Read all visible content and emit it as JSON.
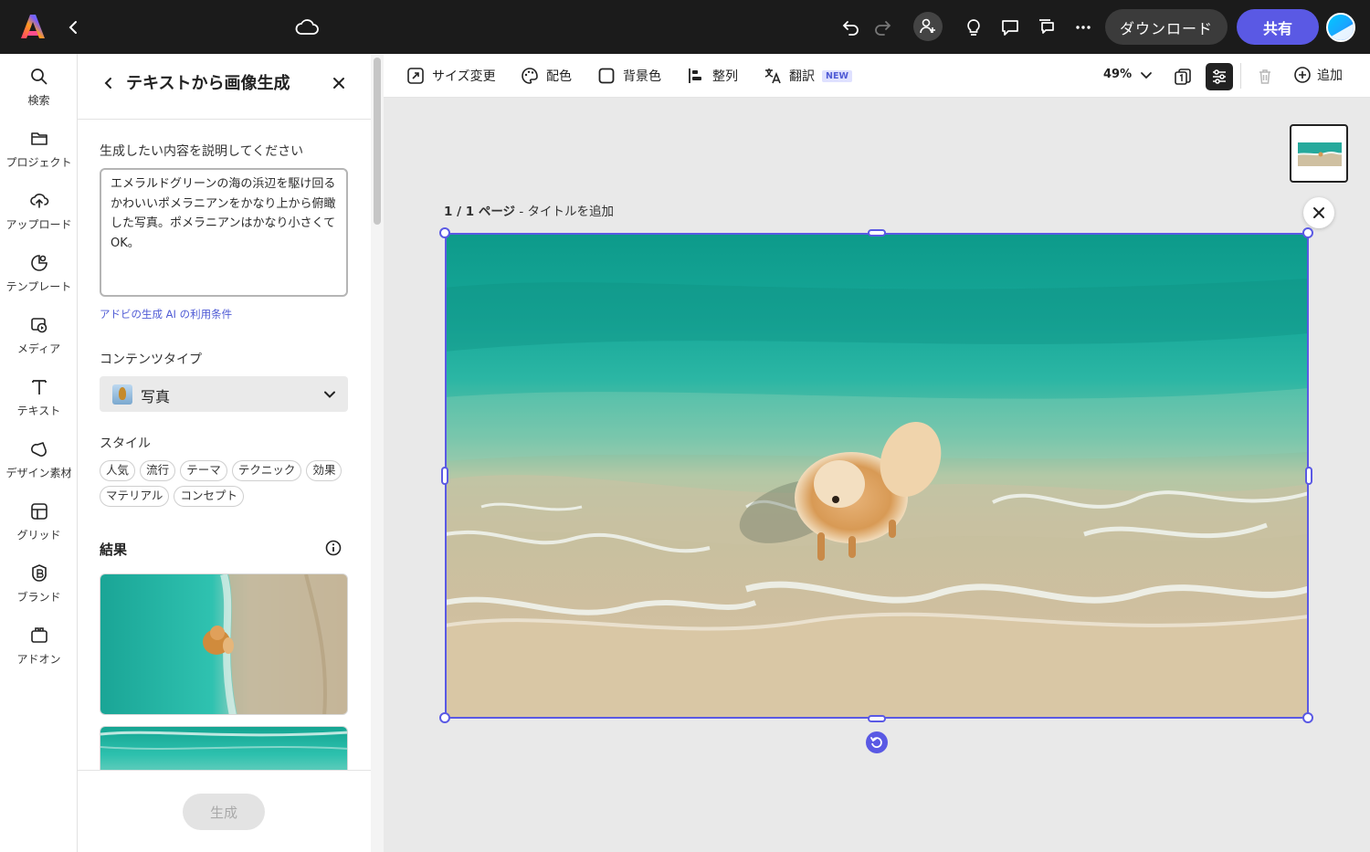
{
  "topbar": {
    "download_label": "ダウンロード",
    "share_label": "共有"
  },
  "rail": [
    {
      "label": "検索",
      "icon": "search-icon"
    },
    {
      "label": "プロジェクト",
      "icon": "folder-icon"
    },
    {
      "label": "アップロード",
      "icon": "upload-icon"
    },
    {
      "label": "テンプレート",
      "icon": "template-icon"
    },
    {
      "label": "メディア",
      "icon": "media-icon"
    },
    {
      "label": "テキスト",
      "icon": "text-icon"
    },
    {
      "label": "デザイン素材",
      "icon": "shapes-icon"
    },
    {
      "label": "グリッド",
      "icon": "grid-icon"
    },
    {
      "label": "ブランド",
      "icon": "brand-icon"
    },
    {
      "label": "アドオン",
      "icon": "addon-icon"
    }
  ],
  "panel": {
    "title": "テキストから画像生成",
    "prompt_label": "生成したい内容を説明してください",
    "prompt_value": "エメラルドグリーンの海の浜辺を駆け回るかわいいポメラニアンをかなり上から俯瞰した写真。ポメラニアンはかなり小さくてOK。",
    "terms_link": "アドビの生成 AI の利用条件",
    "content_type_label": "コンテンツタイプ",
    "content_type_value": "写真",
    "style_label": "スタイル",
    "style_chips": [
      "人気",
      "流行",
      "テーマ",
      "テクニック",
      "効果",
      "マテリアル",
      "コンセプト"
    ],
    "results_label": "結果",
    "generate_label": "生成"
  },
  "toolbar": {
    "resize": "サイズ変更",
    "color": "配色",
    "background": "背景色",
    "align": "整列",
    "translate": "翻訳",
    "new_badge": "NEW",
    "zoom": "49%",
    "add": "追加"
  },
  "canvas": {
    "page_num": "1 / 1 ページ",
    "page_title_placeholder": " - タイトルを追加"
  },
  "colors": {
    "accent": "#5a59e4",
    "topbar_bg": "#1b1b1b",
    "canvas_bg": "#e9e9e9"
  }
}
